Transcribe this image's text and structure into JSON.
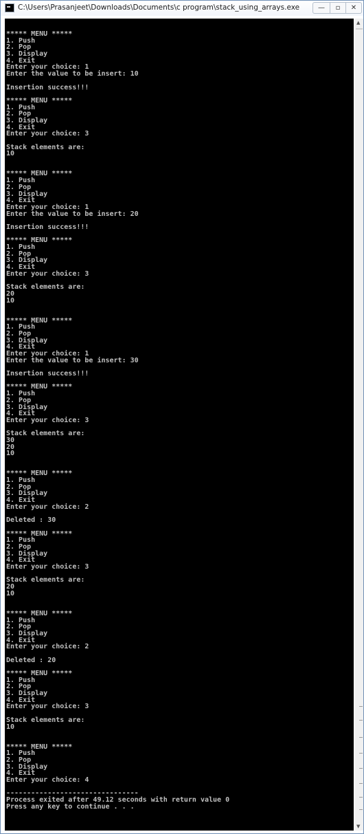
{
  "window": {
    "title": "C:\\Users\\Prasanjeet\\Downloads\\Documents\\c program\\stack_using_arrays.exe",
    "minimize_glyph": "—",
    "maximize_glyph": "▫",
    "close_glyph": "✕"
  },
  "scrollbar": {
    "up_glyph": "▲",
    "down_glyph": "▼"
  },
  "console": {
    "lines": [
      "***** MENU *****",
      "1. Push",
      "2. Pop",
      "3. Display",
      "4. Exit",
      "Enter your choice: 1",
      "Enter the value to be insert: 10",
      "",
      "Insertion success!!!",
      "",
      "***** MENU *****",
      "1. Push",
      "2. Pop",
      "3. Display",
      "4. Exit",
      "Enter your choice: 3",
      "",
      "Stack elements are:",
      "10",
      "",
      "",
      "***** MENU *****",
      "1. Push",
      "2. Pop",
      "3. Display",
      "4. Exit",
      "Enter your choice: 1",
      "Enter the value to be insert: 20",
      "",
      "Insertion success!!!",
      "",
      "***** MENU *****",
      "1. Push",
      "2. Pop",
      "3. Display",
      "4. Exit",
      "Enter your choice: 3",
      "",
      "Stack elements are:",
      "20",
      "10",
      "",
      "",
      "***** MENU *****",
      "1. Push",
      "2. Pop",
      "3. Display",
      "4. Exit",
      "Enter your choice: 1",
      "Enter the value to be insert: 30",
      "",
      "Insertion success!!!",
      "",
      "***** MENU *****",
      "1. Push",
      "2. Pop",
      "3. Display",
      "4. Exit",
      "Enter your choice: 3",
      "",
      "Stack elements are:",
      "30",
      "20",
      "10",
      "",
      "",
      "***** MENU *****",
      "1. Push",
      "2. Pop",
      "3. Display",
      "4. Exit",
      "Enter your choice: 2",
      "",
      "Deleted : 30",
      "",
      "***** MENU *****",
      "1. Push",
      "2. Pop",
      "3. Display",
      "4. Exit",
      "Enter your choice: 3",
      "",
      "Stack elements are:",
      "20",
      "10",
      "",
      "",
      "***** MENU *****",
      "1. Push",
      "2. Pop",
      "3. Display",
      "4. Exit",
      "Enter your choice: 2",
      "",
      "Deleted : 20",
      "",
      "***** MENU *****",
      "1. Push",
      "2. Pop",
      "3. Display",
      "4. Exit",
      "Enter your choice: 3",
      "",
      "Stack elements are:",
      "10",
      "",
      "",
      "***** MENU *****",
      "1. Push",
      "2. Pop",
      "3. Display",
      "4. Exit",
      "Enter your choice: 4",
      "",
      "--------------------------------",
      "Process exited after 49.12 seconds with return value 0",
      "Press any key to continue . . ."
    ]
  }
}
